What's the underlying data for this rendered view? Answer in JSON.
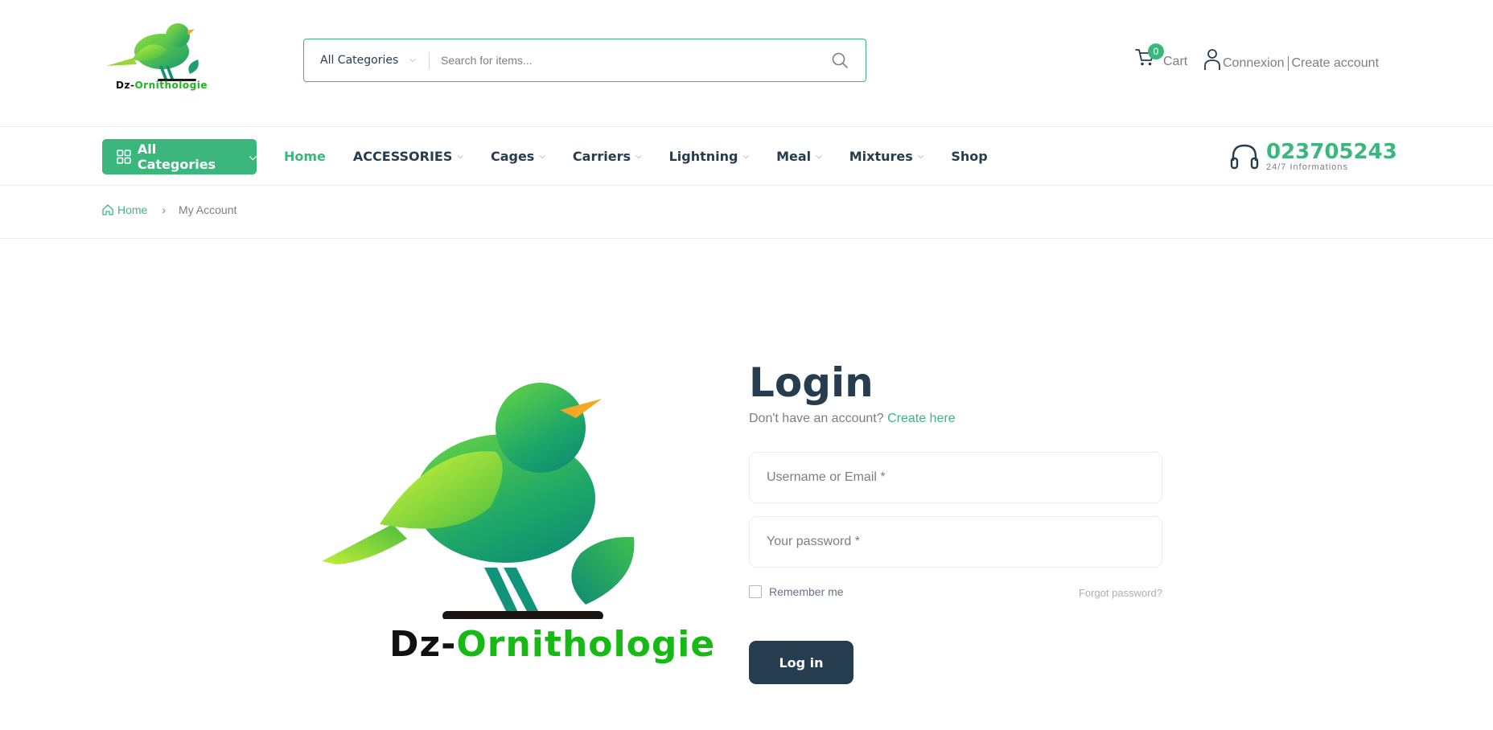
{
  "brand": {
    "name_part1": "Dz-",
    "name_part2": "Ornithologie",
    "accent_color": "#3bb77e",
    "dark_color": "#253d4e"
  },
  "search": {
    "category": "All Categories",
    "placeholder": "Search for items..."
  },
  "header": {
    "cart_count": "0",
    "cart_label": "Cart",
    "login_label": "Connexion",
    "register_label": "Create account"
  },
  "nav": {
    "all_categories": "All Categories",
    "items": [
      {
        "label": "Home"
      },
      {
        "label": "ACCESSORIES"
      },
      {
        "label": "Cages"
      },
      {
        "label": "Carriers"
      },
      {
        "label": "Lightning"
      },
      {
        "label": "Meal"
      },
      {
        "label": "Mixtures"
      },
      {
        "label": "Shop"
      }
    ],
    "hotline_number": "023705243",
    "hotline_sub": "24/7 Informations"
  },
  "breadcrumb": {
    "home": "Home",
    "separator": "›",
    "current": "My Account"
  },
  "login": {
    "title": "Login",
    "no_account_text": "Don't have an account?",
    "create_link": "Create here",
    "username_placeholder": "Username or Email *",
    "password_placeholder": "Your password *",
    "remember_label": "Remember me",
    "forgot_label": "Forgot password?",
    "submit_label": "Log in"
  }
}
